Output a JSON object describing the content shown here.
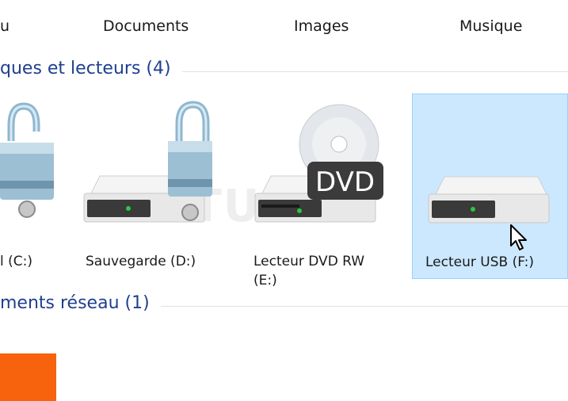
{
  "quick_access": {
    "items": [
      {
        "label": "u"
      },
      {
        "label": "Documents"
      },
      {
        "label": "Images"
      },
      {
        "label": "Musique"
      }
    ]
  },
  "groups": {
    "devices": {
      "title": "ques et lecteurs (4)"
    },
    "network": {
      "title": "ments réseau (1)"
    }
  },
  "drives": [
    {
      "label": "l (C:)",
      "icon": "locked-hard-drive-icon"
    },
    {
      "label": "Sauvegarde (D:)",
      "icon": "locked-hard-drive-icon"
    },
    {
      "label": "Lecteur DVD RW",
      "label_line2": "(E:)",
      "icon": "dvd-drive-icon",
      "badge": "DVD"
    },
    {
      "label": "Lecteur USB (F:)",
      "icon": "usb-drive-icon",
      "selected": true
    }
  ],
  "watermark": "ASTUCES",
  "colors": {
    "group_title": "#1f3f8f",
    "selection_bg": "#cce8ff",
    "selection_border": "#99d1ff",
    "network_tile": "#f7630c"
  }
}
